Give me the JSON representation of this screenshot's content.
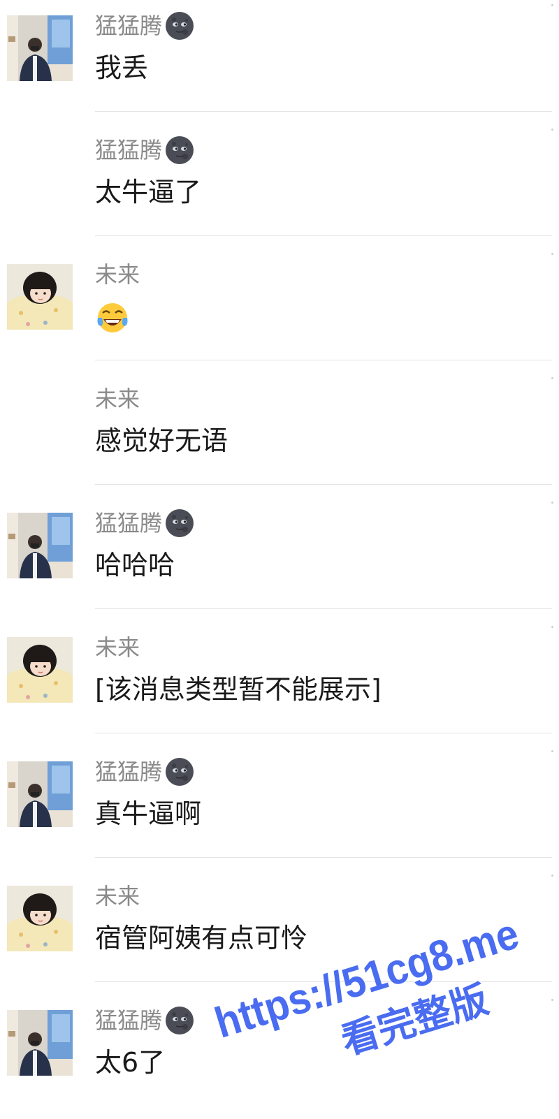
{
  "messages": [
    {
      "sender": "猛猛腾",
      "sender_emoji": "new-moon-face-icon",
      "text": "我丢",
      "show_avatar": true,
      "avatar": "man-avatar"
    },
    {
      "sender": "猛猛腾",
      "sender_emoji": "new-moon-face-icon",
      "text": "太牛逼了",
      "show_avatar": false,
      "avatar": "man-avatar"
    },
    {
      "sender": "未来",
      "sender_emoji": "",
      "text": "",
      "text_emoji": "tears-of-joy-icon",
      "show_avatar": true,
      "avatar": "child-avatar"
    },
    {
      "sender": "未来",
      "sender_emoji": "",
      "text": "感觉好无语",
      "show_avatar": false,
      "avatar": "child-avatar"
    },
    {
      "sender": "猛猛腾",
      "sender_emoji": "new-moon-face-icon",
      "text": "哈哈哈",
      "show_avatar": true,
      "avatar": "man-avatar"
    },
    {
      "sender": "未来",
      "sender_emoji": "",
      "text": "[该消息类型暂不能展示]",
      "show_avatar": true,
      "avatar": "child-avatar"
    },
    {
      "sender": "猛猛腾",
      "sender_emoji": "new-moon-face-icon",
      "text": "真牛逼啊",
      "show_avatar": true,
      "avatar": "man-avatar"
    },
    {
      "sender": "未来",
      "sender_emoji": "",
      "text": "宿管阿姨有点可怜",
      "show_avatar": true,
      "avatar": "child-avatar"
    },
    {
      "sender": "猛猛腾",
      "sender_emoji": "new-moon-face-icon",
      "text": "太6了",
      "show_avatar": true,
      "avatar": "man-avatar"
    }
  ],
  "watermark": {
    "line1": "https://51cg8.me",
    "line2": "看完整版",
    "color": "#4a6cf0"
  },
  "colors": {
    "name": "#8a8a8a",
    "text": "#1a1a1a",
    "divider": "#e4e4e4"
  }
}
